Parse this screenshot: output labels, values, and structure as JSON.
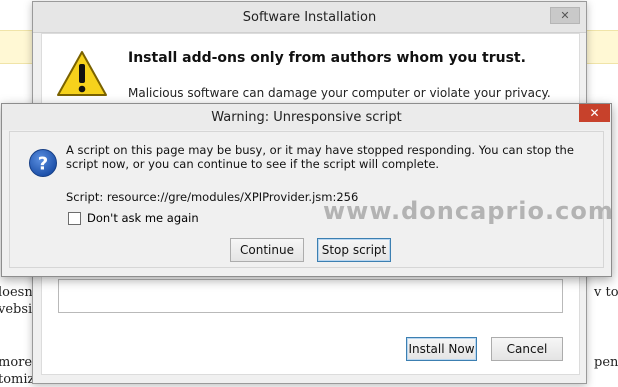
{
  "background_page": {
    "left_fragments": [
      "loesn",
      "vebsit",
      "more",
      "tomiz"
    ],
    "right_fragments": [
      "v to d",
      "pendi"
    ]
  },
  "install_dialog": {
    "title": "Software Installation",
    "heading": "Install add-ons only from authors whom you trust.",
    "description": "Malicious software can damage your computer or violate your privacy.",
    "install_button": "Install Now",
    "cancel_button": "Cancel"
  },
  "script_dialog": {
    "title": "Warning: Unresponsive script",
    "message": "A script on this page may be busy, or it may have stopped responding. You can stop the script now, or you can continue to see if the script will complete.",
    "script_line": "Script: resource://gre/modules/XPIProvider.jsm:256",
    "checkbox_label": "Don't ask me again",
    "checkbox_checked": false,
    "continue_button": "Continue",
    "stop_button": "Stop script",
    "close_color": "#c7412b"
  },
  "watermark": "www.doncaprio.com",
  "icons": {
    "warning": "warning-triangle-icon",
    "question": "question-mark-icon",
    "close": "close-icon"
  }
}
